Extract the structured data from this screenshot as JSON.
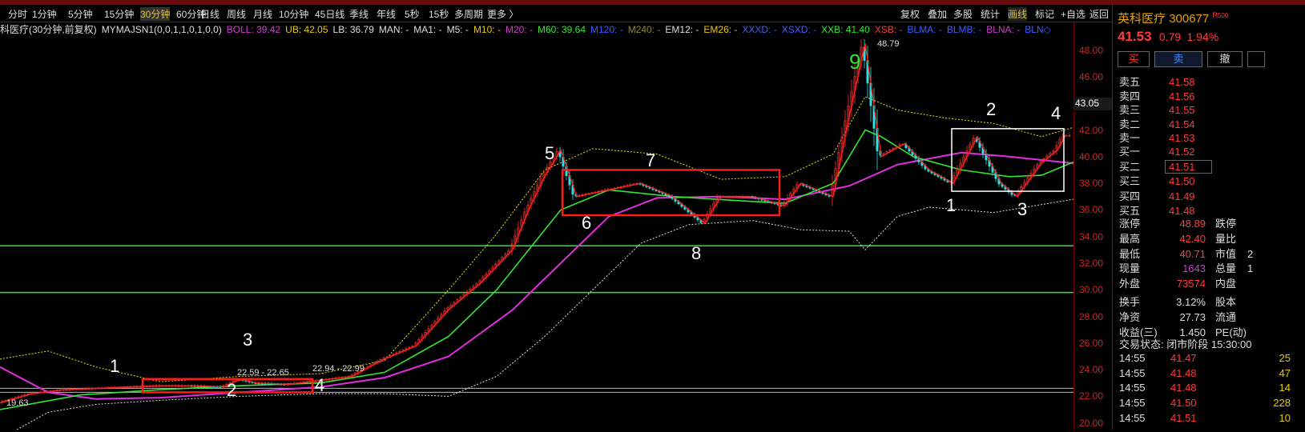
{
  "toolbar": {
    "periods": [
      "分时",
      "1分钟",
      "5分钟",
      "15分钟",
      "30分钟",
      "60分钟",
      "日线",
      "周线",
      "月线",
      "10分钟",
      "45日线",
      "季线",
      "年线",
      "5秒",
      "15秒",
      "多周期",
      "更多 〉"
    ],
    "active_period": "30分钟",
    "right_buttons": [
      "复权",
      "叠加",
      "多股",
      "统计",
      "画线",
      "标记",
      "+自选",
      "返回"
    ],
    "active_right": "画线"
  },
  "indicator_bar": {
    "title": "科医疗(30分钟,前复权)",
    "formula": "MYMAJSN1(0,0,1,1,0,1,0,0)",
    "items": [
      {
        "text": "BOLL: 39.42",
        "color": "#d03bd0"
      },
      {
        "text": "UB: 42.05",
        "color": "#e6c800"
      },
      {
        "text": "LB: 36.79",
        "color": "#dddddd"
      },
      {
        "text": "MAN: -",
        "color": "#dddddd"
      },
      {
        "text": "MA1: -",
        "color": "#dddddd"
      },
      {
        "text": "M5: -",
        "color": "#dddddd"
      },
      {
        "text": "M10: -",
        "color": "#e6c800"
      },
      {
        "text": "M20: -",
        "color": "#d03bd0"
      },
      {
        "text": "M60: 39.64",
        "color": "#32e632"
      },
      {
        "text": "M120: -",
        "color": "#3a5cff"
      },
      {
        "text": "M240: -",
        "color": "#8a8a20"
      },
      {
        "text": "EM12: -",
        "color": "#dddddd"
      },
      {
        "text": "EM26: -",
        "color": "#e6c800"
      },
      {
        "text": "XXXD: -",
        "color": "#3a5cff"
      },
      {
        "text": "XSXD: -",
        "color": "#3a5cff"
      },
      {
        "text": "XXB: 41.40",
        "color": "#32e632"
      },
      {
        "text": "XSB: -",
        "color": "#ff3b3b"
      },
      {
        "text": "BLMA: -",
        "color": "#3a5cff"
      },
      {
        "text": "BLMB: -",
        "color": "#3a5cff"
      },
      {
        "text": "BLNA: -",
        "color": "#d03bd0"
      },
      {
        "text": "BLN◇",
        "color": "#3a5cff"
      }
    ]
  },
  "chart_data": {
    "type": "candlestick",
    "y_ticks": [
      "48.00",
      "46.00",
      "44.00",
      "42.00",
      "40.00",
      "38.00",
      "36.00",
      "34.00",
      "32.00",
      "30.00",
      "28.00",
      "26.00",
      "24.00",
      "22.00",
      "20.00"
    ],
    "ylim": [
      19.5,
      49
    ],
    "current_price_tag": "43.05",
    "price_labels": [
      "48.79",
      "22.59 - 22.65",
      "22.94 - 22.99",
      "19.63"
    ],
    "horizontal_lines": [
      33.3,
      29.8,
      22.6,
      22.3
    ],
    "close_path": [
      [
        0,
        21.5
      ],
      [
        40,
        22.2
      ],
      [
        80,
        22.5
      ],
      [
        120,
        22.6
      ],
      [
        160,
        22.7
      ],
      [
        200,
        22.8
      ],
      [
        240,
        22.8
      ],
      [
        280,
        22.7
      ],
      [
        300,
        23.3
      ],
      [
        320,
        23.0
      ],
      [
        360,
        22.9
      ],
      [
        400,
        23.2
      ],
      [
        440,
        23.5
      ],
      [
        480,
        24.8
      ],
      [
        520,
        25.8
      ],
      [
        560,
        28.5
      ],
      [
        600,
        30.5
      ],
      [
        640,
        33
      ],
      [
        660,
        36
      ],
      [
        680,
        38.5
      ],
      [
        700,
        40.5
      ],
      [
        720,
        37
      ],
      [
        760,
        37.5
      ],
      [
        800,
        38
      ],
      [
        820,
        37.5
      ],
      [
        840,
        37
      ],
      [
        880,
        35
      ],
      [
        900,
        37
      ],
      [
        940,
        37
      ],
      [
        980,
        36.3
      ],
      [
        1000,
        38
      ],
      [
        1020,
        37.5
      ],
      [
        1040,
        37
      ],
      [
        1060,
        43
      ],
      [
        1080,
        48.5
      ],
      [
        1100,
        40
      ],
      [
        1130,
        41
      ],
      [
        1160,
        39
      ],
      [
        1190,
        38
      ],
      [
        1220,
        41.5
      ],
      [
        1250,
        38
      ],
      [
        1270,
        37
      ],
      [
        1300,
        39.5
      ],
      [
        1320,
        40.5
      ],
      [
        1330,
        41.6
      ]
    ],
    "ma_green": [
      [
        0,
        21
      ],
      [
        100,
        22.1
      ],
      [
        200,
        22.5
      ],
      [
        300,
        22.8
      ],
      [
        400,
        23.0
      ],
      [
        480,
        23.8
      ],
      [
        560,
        26.5
      ],
      [
        620,
        30
      ],
      [
        660,
        33
      ],
      [
        700,
        36
      ],
      [
        760,
        37.5
      ],
      [
        840,
        37
      ],
      [
        920,
        36.7
      ],
      [
        980,
        36.5
      ],
      [
        1040,
        38
      ],
      [
        1080,
        42
      ],
      [
        1100,
        41.5
      ],
      [
        1140,
        40
      ],
      [
        1200,
        39
      ],
      [
        1260,
        38.5
      ],
      [
        1300,
        38.6
      ],
      [
        1340,
        39.6
      ]
    ],
    "ma_magenta": [
      [
        0,
        24.2
      ],
      [
        60,
        22.3
      ],
      [
        120,
        21.8
      ],
      [
        200,
        21.9
      ],
      [
        300,
        22.3
      ],
      [
        400,
        22.7
      ],
      [
        480,
        23.4
      ],
      [
        560,
        25
      ],
      [
        640,
        28.5
      ],
      [
        700,
        32
      ],
      [
        760,
        35.5
      ],
      [
        820,
        36.9
      ],
      [
        900,
        37
      ],
      [
        980,
        36.8
      ],
      [
        1060,
        37.8
      ],
      [
        1120,
        39.4
      ],
      [
        1200,
        40.3
      ],
      [
        1260,
        40.0
      ],
      [
        1340,
        39.5
      ]
    ],
    "boll_upper": [
      [
        0,
        24.8
      ],
      [
        60,
        25.4
      ],
      [
        120,
        24.2
      ],
      [
        200,
        23.1
      ],
      [
        300,
        23.5
      ],
      [
        400,
        23.7
      ],
      [
        480,
        24.7
      ],
      [
        560,
        30
      ],
      [
        620,
        34.2
      ],
      [
        680,
        39
      ],
      [
        740,
        40.6
      ],
      [
        820,
        40.2
      ],
      [
        900,
        38.3
      ],
      [
        980,
        38.5
      ],
      [
        1040,
        40.2
      ],
      [
        1080,
        44.5
      ],
      [
        1120,
        43.5
      ],
      [
        1180,
        42.9
      ],
      [
        1240,
        42.5
      ],
      [
        1300,
        41.5
      ],
      [
        1340,
        42.2
      ]
    ],
    "boll_lower": [
      [
        0,
        18.8
      ],
      [
        60,
        20.8
      ],
      [
        120,
        21.4
      ],
      [
        200,
        21.7
      ],
      [
        300,
        22.0
      ],
      [
        400,
        22.2
      ],
      [
        480,
        22.2
      ],
      [
        560,
        22
      ],
      [
        620,
        23.5
      ],
      [
        680,
        26.5
      ],
      [
        740,
        30
      ],
      [
        800,
        33.5
      ],
      [
        860,
        34.9
      ],
      [
        940,
        35.2
      ],
      [
        1000,
        34.5
      ],
      [
        1060,
        34.4
      ],
      [
        1080,
        33
      ],
      [
        1120,
        35.5
      ],
      [
        1160,
        36.2
      ],
      [
        1240,
        35.8
      ],
      [
        1300,
        36.4
      ],
      [
        1340,
        36.8
      ]
    ],
    "boxes": [
      {
        "color": "red",
        "x1": 178,
        "x2": 390,
        "y1": 22.3,
        "y2": 23.3
      },
      {
        "color": "red",
        "x1": 702,
        "x2": 973,
        "y1": 35.6,
        "y2": 39.0
      },
      {
        "color": "white",
        "x1": 1188,
        "x2": 1328,
        "y1": 37.4,
        "y2": 42.1
      }
    ]
  },
  "annotations": [
    {
      "text": "1",
      "color": "#ffffff"
    },
    {
      "text": "2",
      "color": "#ffffff"
    },
    {
      "text": "3",
      "color": "#ffffff"
    },
    {
      "text": "4",
      "color": "#ffffff"
    },
    {
      "text": "5",
      "color": "#ffffff"
    },
    {
      "text": "6",
      "color": "#ffffff"
    },
    {
      "text": "7",
      "color": "#ffffff"
    },
    {
      "text": "8",
      "color": "#ffffff"
    },
    {
      "text": "9",
      "color": "#32e632"
    },
    {
      "text": "1",
      "color": "#ffffff"
    },
    {
      "text": "2",
      "color": "#ffffff"
    },
    {
      "text": "3",
      "color": "#ffffff"
    },
    {
      "text": "4",
      "color": "#ffffff"
    }
  ],
  "sidebar": {
    "name": "英科医疗",
    "code": "300677",
    "badge": "R",
    "badge_num": "500",
    "price": "41.53",
    "change": "0.79",
    "change_pct": "1.94%",
    "buy_label": "买",
    "sell_label": "卖",
    "cancel_label": "撤",
    "asks": [
      {
        "label": "卖五",
        "price": "41.58"
      },
      {
        "label": "卖四",
        "price": "41.56"
      },
      {
        "label": "卖三",
        "price": "41.55"
      },
      {
        "label": "卖二",
        "price": "41.54"
      },
      {
        "label": "卖一",
        "price": "41.53"
      }
    ],
    "bids": [
      {
        "label": "买一",
        "price": "41.52"
      },
      {
        "label": "买二",
        "price": "41.51"
      },
      {
        "label": "买三",
        "price": "41.50"
      },
      {
        "label": "买四",
        "price": "41.49"
      },
      {
        "label": "买五",
        "price": "41.48"
      }
    ],
    "stats": [
      {
        "l": "涨停",
        "v": "48.89",
        "vc": "red",
        "l2": "跌停",
        "v2": ""
      },
      {
        "l": "最高",
        "v": "42.40",
        "vc": "red",
        "l2": "量比",
        "v2": ""
      },
      {
        "l": "最低",
        "v": "40.71",
        "vc": "red",
        "l2": "市值",
        "v2": "2"
      },
      {
        "l": "现量",
        "v": "1643",
        "vc": "purple",
        "l2": "总量",
        "v2": "1"
      },
      {
        "l": "外盘",
        "v": "73574",
        "vc": "red",
        "l2": "内盘",
        "v2": ""
      },
      {
        "l": "换手",
        "v": "3.12%",
        "vc": "white",
        "l2": "股本",
        "v2": ""
      },
      {
        "l": "净资",
        "v": "27.73",
        "vc": "white",
        "l2": "流通",
        "v2": ""
      },
      {
        "l": "收益(三)",
        "v": "1.450",
        "vc": "white",
        "l2": "PE(动)",
        "v2": ""
      }
    ],
    "trade_status": "交易状态: 闭市阶段 15:30:00",
    "ticks": [
      {
        "t": "14:55",
        "p": "41.47",
        "v": "25",
        "vc": "yellow"
      },
      {
        "t": "14:55",
        "p": "41.48",
        "v": "47",
        "vc": "yellow"
      },
      {
        "t": "14:55",
        "p": "41.48",
        "v": "14",
        "vc": "yellow"
      },
      {
        "t": "14:55",
        "p": "41.50",
        "v": "228",
        "vc": "yellow"
      },
      {
        "t": "14:55",
        "p": "41.51",
        "v": "10",
        "vc": "yellow"
      }
    ]
  }
}
